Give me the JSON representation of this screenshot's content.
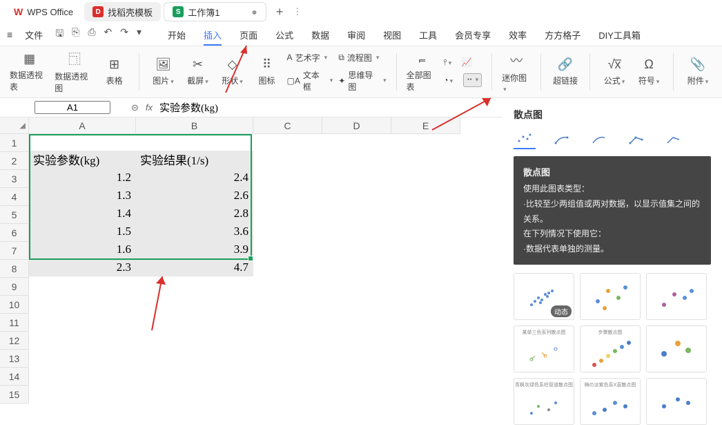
{
  "app": {
    "name": "WPS Office",
    "template_tab": "找稻壳模板",
    "workbook_tab": "工作簿1"
  },
  "menu": {
    "file": "文件",
    "tabs": [
      "开始",
      "插入",
      "页面",
      "公式",
      "数据",
      "审阅",
      "视图",
      "工具",
      "会员专享",
      "效率",
      "方方格子",
      "DIY工具箱"
    ],
    "active": "插入"
  },
  "ribbon": {
    "pivot_table": "数据透视表",
    "pivot_chart": "数据透视图",
    "table": "表格",
    "picture": "图片",
    "screenshot": "截屏",
    "shape": "形状",
    "icon": "图标",
    "wordart": "艺术字",
    "textbox": "文本框",
    "flowchart": "流程图",
    "mindmap": "思维导图",
    "all_charts": "全部图表",
    "sparkline": "迷你图",
    "hyperlink": "超链接",
    "formula": "公式",
    "symbol": "符号",
    "attachment": "附件"
  },
  "namebox": "A1",
  "fx": "fx",
  "formula_text": "实验参数(kg)",
  "cols": [
    "A",
    "B",
    "C",
    "D",
    "E"
  ],
  "rows": [
    "1",
    "2",
    "3",
    "4",
    "5",
    "6",
    "7",
    "8",
    "9",
    "10",
    "11",
    "12",
    "13",
    "14",
    "15"
  ],
  "sheet": {
    "headers": {
      "a": "实验参数(kg)",
      "b": "实验结果(1/s)"
    },
    "data": [
      {
        "a": "1.2",
        "b": "2.4"
      },
      {
        "a": "1.3",
        "b": "2.6"
      },
      {
        "a": "1.4",
        "b": "2.8"
      },
      {
        "a": "1.5",
        "b": "3.6"
      },
      {
        "a": "1.6",
        "b": "3.9"
      },
      {
        "a": "2.3",
        "b": "4.7"
      }
    ]
  },
  "chart_data": {
    "type": "scatter",
    "x": [
      1.2,
      1.3,
      1.4,
      1.5,
      1.6,
      2.3
    ],
    "y": [
      2.4,
      2.6,
      2.8,
      3.6,
      3.9,
      4.7
    ],
    "xlabel": "实验参数(kg)",
    "ylabel": "实验结果(1/s)"
  },
  "panel": {
    "title": "散点图",
    "tip": {
      "name": "散点图",
      "line1": "使用此图表类型：",
      "line2": "·比较至少两组值或两对数据，以显示值集之间的关系。",
      "line3": "在下列情况下使用它：",
      "line4": "·数据代表单独的测量。"
    },
    "dynamic": "动态",
    "thumb_titles": [
      "",
      "",
      "",
      "某单三色系列散点图",
      "步骤散点图",
      "",
      "青枫灰绿色系柱管道散点图",
      "梅の淡紫色系X直散点图",
      ""
    ]
  }
}
